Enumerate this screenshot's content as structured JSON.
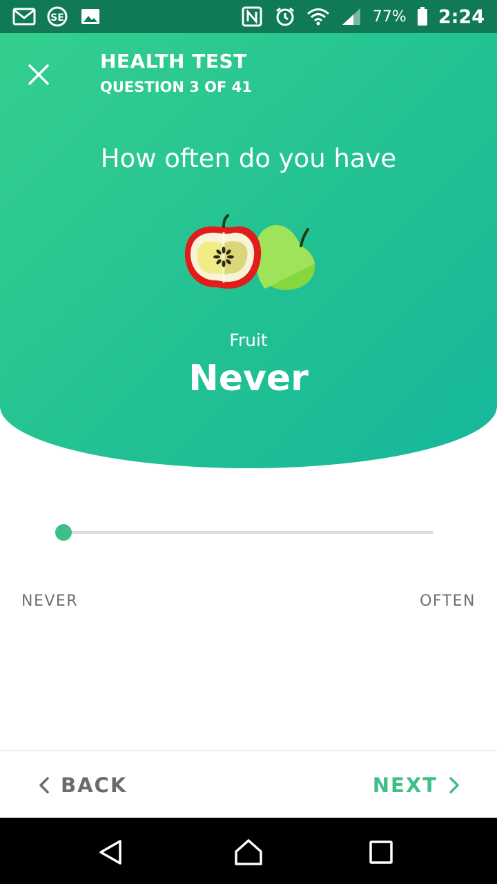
{
  "status_bar": {
    "battery_percent": "77%",
    "time": "2:24",
    "left_icons": [
      "gmail-icon",
      "se-app-icon",
      "gallery-icon"
    ],
    "right_icons": [
      "nfc-icon",
      "alarm-icon",
      "wifi-icon",
      "signal-icon",
      "battery-icon"
    ]
  },
  "header": {
    "title": "HEALTH TEST",
    "progress_text": "QUESTION 3 OF 41",
    "close_icon": "close-icon"
  },
  "question": {
    "prompt": "How often do you have",
    "item_icon": "fruit-apple-pear-illustration",
    "item_name": "Fruit",
    "selected_answer": "Never"
  },
  "slider": {
    "value_fraction": 0,
    "min_label": "NEVER",
    "max_label": "OFTEN"
  },
  "footer": {
    "back_label": "BACK",
    "next_label": "NEXT"
  },
  "colors": {
    "accent": "#3dbf87",
    "hero_gradient_start": "#34cf8e",
    "hero_gradient_end": "#16b79b",
    "status_bar": "#0f7a54"
  }
}
